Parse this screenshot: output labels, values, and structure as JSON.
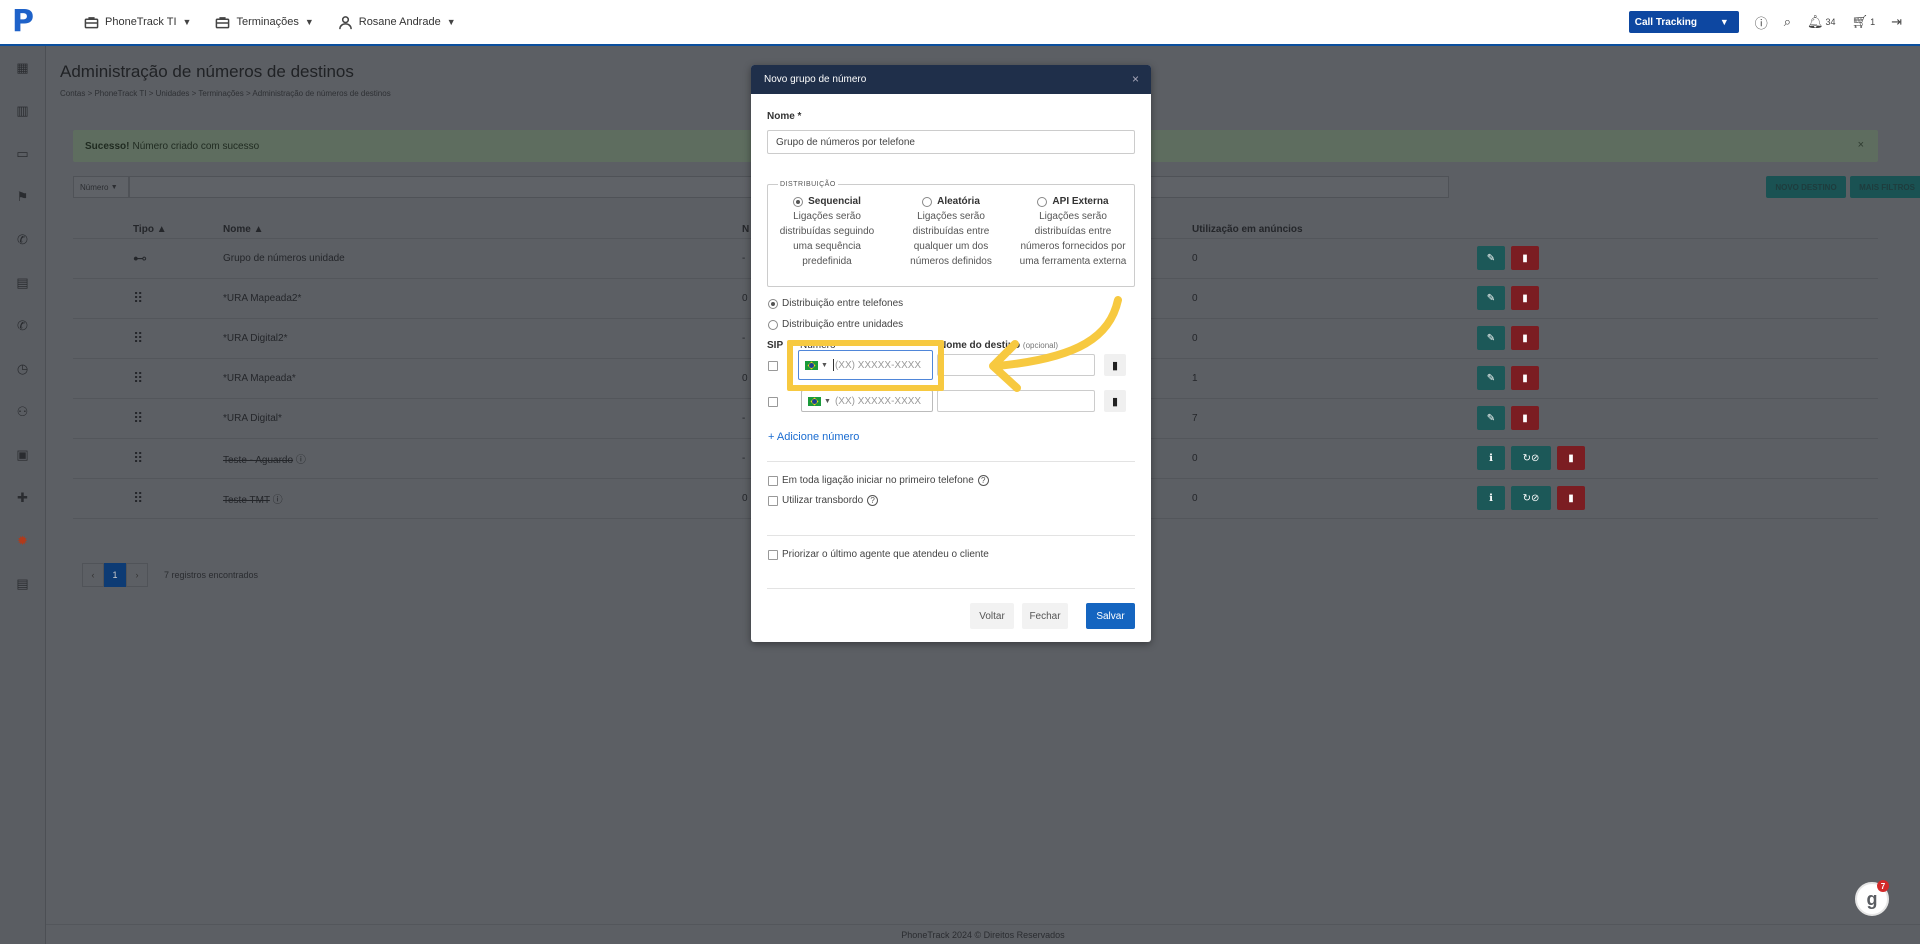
{
  "topbar": {
    "nav": [
      {
        "label": "PhoneTrack TI",
        "icon": "briefcase-icon"
      },
      {
        "label": "Terminações",
        "icon": "briefcase-icon"
      },
      {
        "label": "Rosane Andrade",
        "icon": "user-icon"
      }
    ],
    "call_tracking_label": "Call Tracking",
    "notif_count": "34",
    "cart_count": "1"
  },
  "sidebar_icons": [
    "dashboard-icon",
    "building-icon",
    "briefcase-icon",
    "flag-icon",
    "phone-icon",
    "contact-card-icon",
    "phone-forward-icon",
    "clock-icon",
    "users-icon",
    "gallery-icon",
    "puzzle-icon",
    "settings-icon",
    "store-icon"
  ],
  "page": {
    "title": "Administração de números de destinos",
    "breadcrumb": "Contas  >  PhoneTrack TI  >  Unidades  >  Terminações  >  Administração de números de destinos",
    "alert_strong": "Sucesso!",
    "alert_text": "Número criado com sucesso",
    "filter_select": "Número",
    "btn_new": "NOVO DESTINO",
    "btn_filters": "MAIS FILTROS",
    "columns": {
      "tipo": "Tipo",
      "nome": "Nome",
      "n": "N",
      "uso": "Utilização em anúncios"
    },
    "rows": [
      {
        "icon": "key-icon",
        "icon_glyph": "⊷",
        "name": "Grupo de números unidade",
        "n": "-",
        "uso": "0",
        "deleted": false
      },
      {
        "icon": "dialpad-icon",
        "icon_glyph": "⠿",
        "name": "*URA Mapeada2*",
        "n": "0",
        "uso": "0",
        "deleted": false
      },
      {
        "icon": "dialpad-icon",
        "icon_glyph": "⠿",
        "name": "*URA Digital2*",
        "n": "-",
        "uso": "0",
        "deleted": false
      },
      {
        "icon": "dialpad-icon",
        "icon_glyph": "⠿",
        "name": "*URA Mapeada*",
        "n": "0",
        "uso": "1",
        "deleted": false
      },
      {
        "icon": "dialpad-icon",
        "icon_glyph": "⠿",
        "name": "*URA Digital*",
        "n": "-",
        "uso": "7",
        "deleted": false
      },
      {
        "icon": "dialpad-icon",
        "icon_glyph": "⠿",
        "name": "Teste - Aguardo",
        "n": "-",
        "uso": "0",
        "deleted": true
      },
      {
        "icon": "dialpad-icon",
        "icon_glyph": "⠿",
        "name": "Teste TMT",
        "n": "0",
        "uso": "0",
        "deleted": true
      }
    ],
    "pager": {
      "prev": "‹",
      "current": "1",
      "next": "›",
      "count": "7 registros encontrados"
    },
    "footer": "PhoneTrack 2024 © Direitos Reservados"
  },
  "modal": {
    "title": "Novo grupo de número",
    "name_label": "Nome *",
    "name_value": "Grupo de números por telefone",
    "dist_legend": "DISTRIBUIÇÃO",
    "options": [
      {
        "title": "Sequencial",
        "desc": "Ligações serão distribuídas seguindo uma sequência predefinida",
        "selected": true
      },
      {
        "title": "Aleatória",
        "desc": "Ligações serão distribuídas entre qualquer um dos números definidos",
        "selected": false
      },
      {
        "title": "API Externa",
        "desc": "Ligações serão distribuídas entre números fornecidos por uma ferramenta externa",
        "selected": false
      }
    ],
    "between_phones": "Distribuição entre telefones",
    "between_units": "Distribuição entre unidades",
    "col_sip": "SIP",
    "col_number": "Número",
    "col_dest": "Nome do destino",
    "col_optional": "(opcional)",
    "phone_placeholder": "(XX) XXXXX-XXXX",
    "add_number": "+ Adicione número",
    "first_phone": "Em toda ligação iniciar no primeiro telefone",
    "overflow": "Utilizar transbordo",
    "prioritize": "Priorizar o último agente que atendeu o cliente",
    "btn_back": "Voltar",
    "btn_close": "Fechar",
    "btn_save": "Salvar"
  },
  "chat_badge": "7",
  "colors": {
    "brand": "#0d47a1",
    "highlight": "#f7c940",
    "save": "#1565c0"
  }
}
